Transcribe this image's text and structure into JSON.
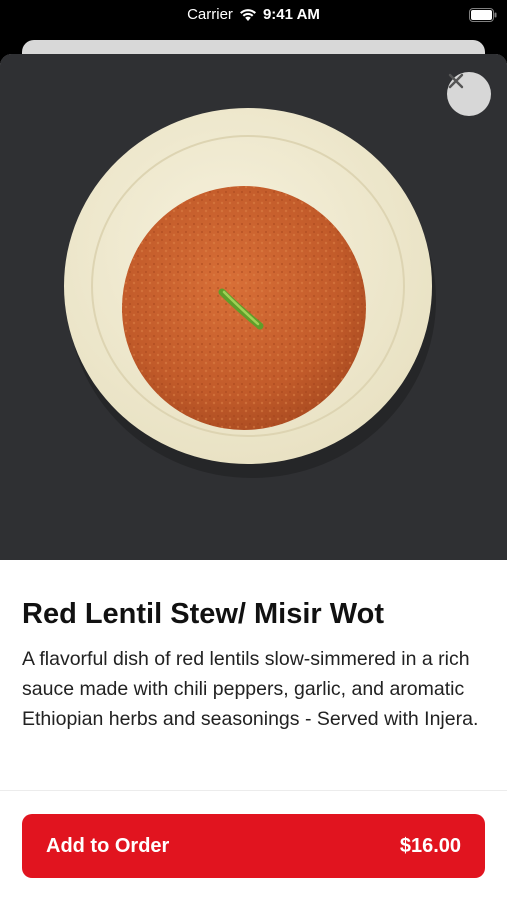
{
  "status_bar": {
    "carrier": "Carrier",
    "time": "9:41 AM",
    "wifi_icon": "wifi-icon",
    "battery_icon": "battery-icon"
  },
  "hero": {
    "image": "photo of a plate of red lentil stew with a green chili on top",
    "close_icon": "close-icon"
  },
  "item": {
    "title": "Red Lentil Stew/ Misir Wot",
    "description": "A flavorful dish of red lentils slow-simmered in a rich sauce made with chili peppers, garlic, and aromatic Ethiopian herbs and seasonings - Served with Injera."
  },
  "order_button": {
    "label": "Add to Order",
    "price": "$16.00"
  },
  "colors": {
    "accent": "#e1141f",
    "hero_background": "#2f3033",
    "text_primary": "#111111"
  }
}
